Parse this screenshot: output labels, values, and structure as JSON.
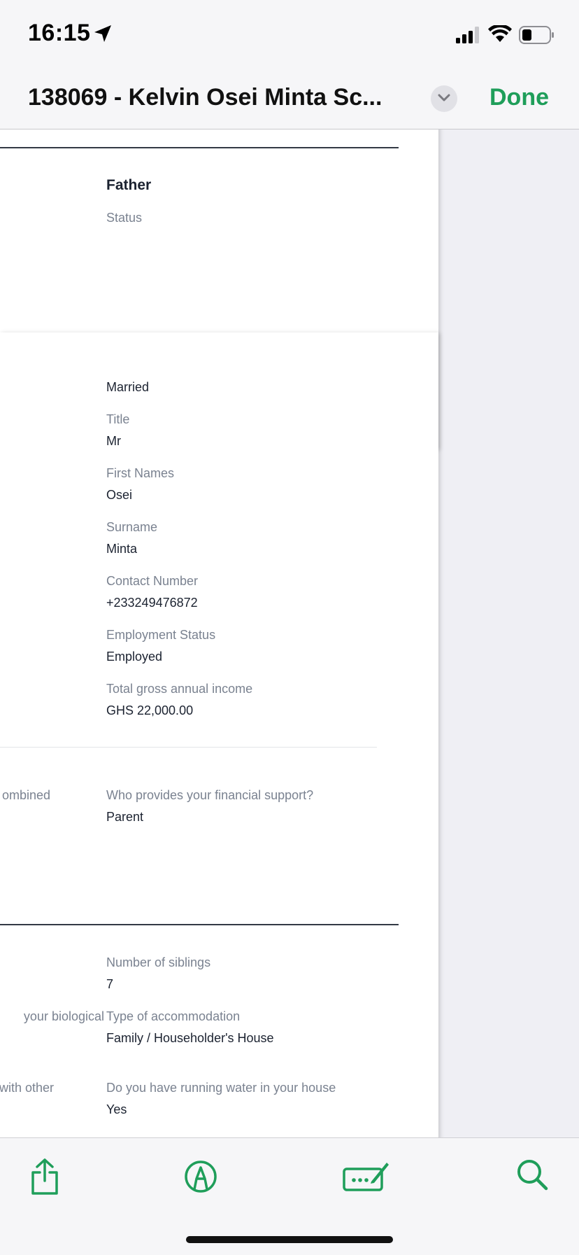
{
  "status_bar": {
    "time": "16:15"
  },
  "nav": {
    "title": "138069 - Kelvin Osei Minta  Sc...",
    "done_label": "Done"
  },
  "page1": {
    "heading": "Father",
    "status_label": "Status"
  },
  "page2": {
    "marital_value": "Married",
    "fields": [
      {
        "label": "Title",
        "value": "Mr"
      },
      {
        "label": "First Names",
        "value": "Osei"
      },
      {
        "label": "Surname",
        "value": "Minta"
      },
      {
        "label": "Contact Number",
        "value": "+233249476872"
      },
      {
        "label": "Employment Status",
        "value": "Employed"
      },
      {
        "label": "Total gross annual income",
        "value": "GHS 22,000.00"
      }
    ],
    "support": {
      "left_fragment": "ombined",
      "label": "Who provides your financial support?",
      "value": "Parent"
    },
    "household": [
      {
        "left_fragment": "",
        "label": "Number of siblings",
        "value": "7"
      },
      {
        "left_fragment": "your biological",
        "label": "Type of accommodation",
        "value": "Family / Householder's House"
      },
      {
        "left_fragment": "with other",
        "label": "Do you have running water in your house",
        "value": "Yes"
      }
    ]
  },
  "colors": {
    "accent": "#1f9e5a"
  }
}
